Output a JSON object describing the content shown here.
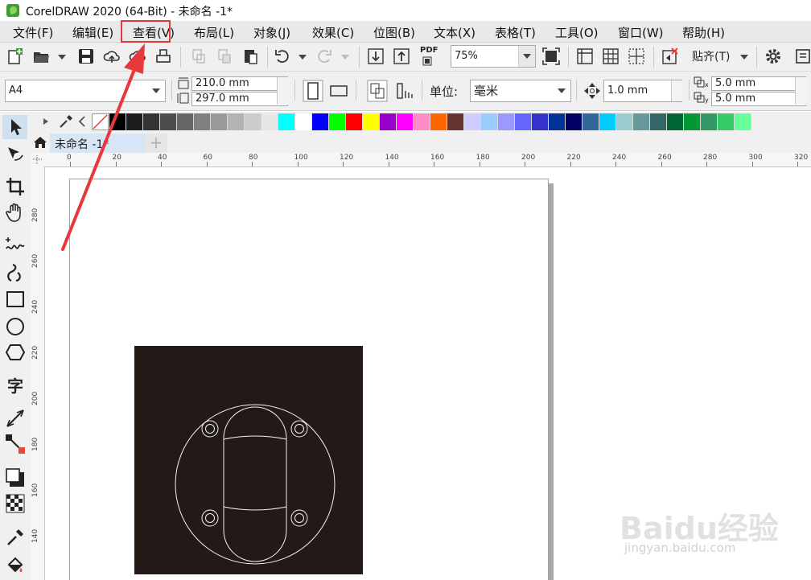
{
  "window": {
    "title": "CorelDRAW 2020 (64-Bit) - 未命名 -1*"
  },
  "menu": {
    "items": [
      {
        "label": "文件(F)"
      },
      {
        "label": "编辑(E)"
      },
      {
        "label": "查看(V)"
      },
      {
        "label": "布局(L)"
      },
      {
        "label": "对象(J)"
      },
      {
        "label": "效果(C)"
      },
      {
        "label": "位图(B)"
      },
      {
        "label": "文本(X)"
      },
      {
        "label": "表格(T)"
      },
      {
        "label": "工具(O)"
      },
      {
        "label": "窗口(W)"
      },
      {
        "label": "帮助(H)"
      }
    ],
    "highlighted": "查看(V)",
    "highlight_color": "#e8383b"
  },
  "toolbar": {
    "zoom_value": "75%",
    "snap_label": "贴齐(T)",
    "pdf_label": "PDF"
  },
  "property_bar": {
    "page_size": "A4",
    "width": "210.0 mm",
    "height": "297.0 mm",
    "units_label": "单位:",
    "units_value": "毫米",
    "nudge": "1.0 mm",
    "dup_x": "5.0 mm",
    "dup_y": "5.0 mm",
    "x_sub": "x",
    "y_sub": "y"
  },
  "palette": {
    "colors": [
      "#000000",
      "#1c1c1c",
      "#333333",
      "#4d4d4d",
      "#666666",
      "#808080",
      "#999999",
      "#b3b3b3",
      "#cccccc",
      "#e6e6e6",
      "#00ffff",
      "#ffffff",
      "#0000ff",
      "#00ff00",
      "#ff0000",
      "#ffff00",
      "#9900cc",
      "#ff00ff",
      "#ff8ac8",
      "#ff6600",
      "#663333",
      "#ccccff",
      "#99ccff",
      "#9999ff",
      "#6666ff",
      "#3333cc",
      "#003399",
      "#000066",
      "#336699",
      "#00ccff",
      "#99cccc",
      "#669999",
      "#336666",
      "#006633",
      "#009933",
      "#339966",
      "#33cc66",
      "#66ff99"
    ]
  },
  "document": {
    "tab_title": "未命名 -1*",
    "add_tab": "+"
  },
  "rulers": {
    "h_labels": [
      "0",
      "20",
      "40",
      "60",
      "80",
      "100",
      "120",
      "140",
      "160",
      "180",
      "200",
      "220",
      "240",
      "260",
      "280",
      "300",
      "320"
    ],
    "v_labels": [
      "280",
      "260",
      "240",
      "220",
      "200",
      "180",
      "160",
      "140"
    ]
  },
  "watermark": {
    "brand": "Baidu经验",
    "url": "jingyan.baidu.com"
  },
  "artwork": {
    "background": "#231a17",
    "stroke": "#f2f2f2"
  }
}
